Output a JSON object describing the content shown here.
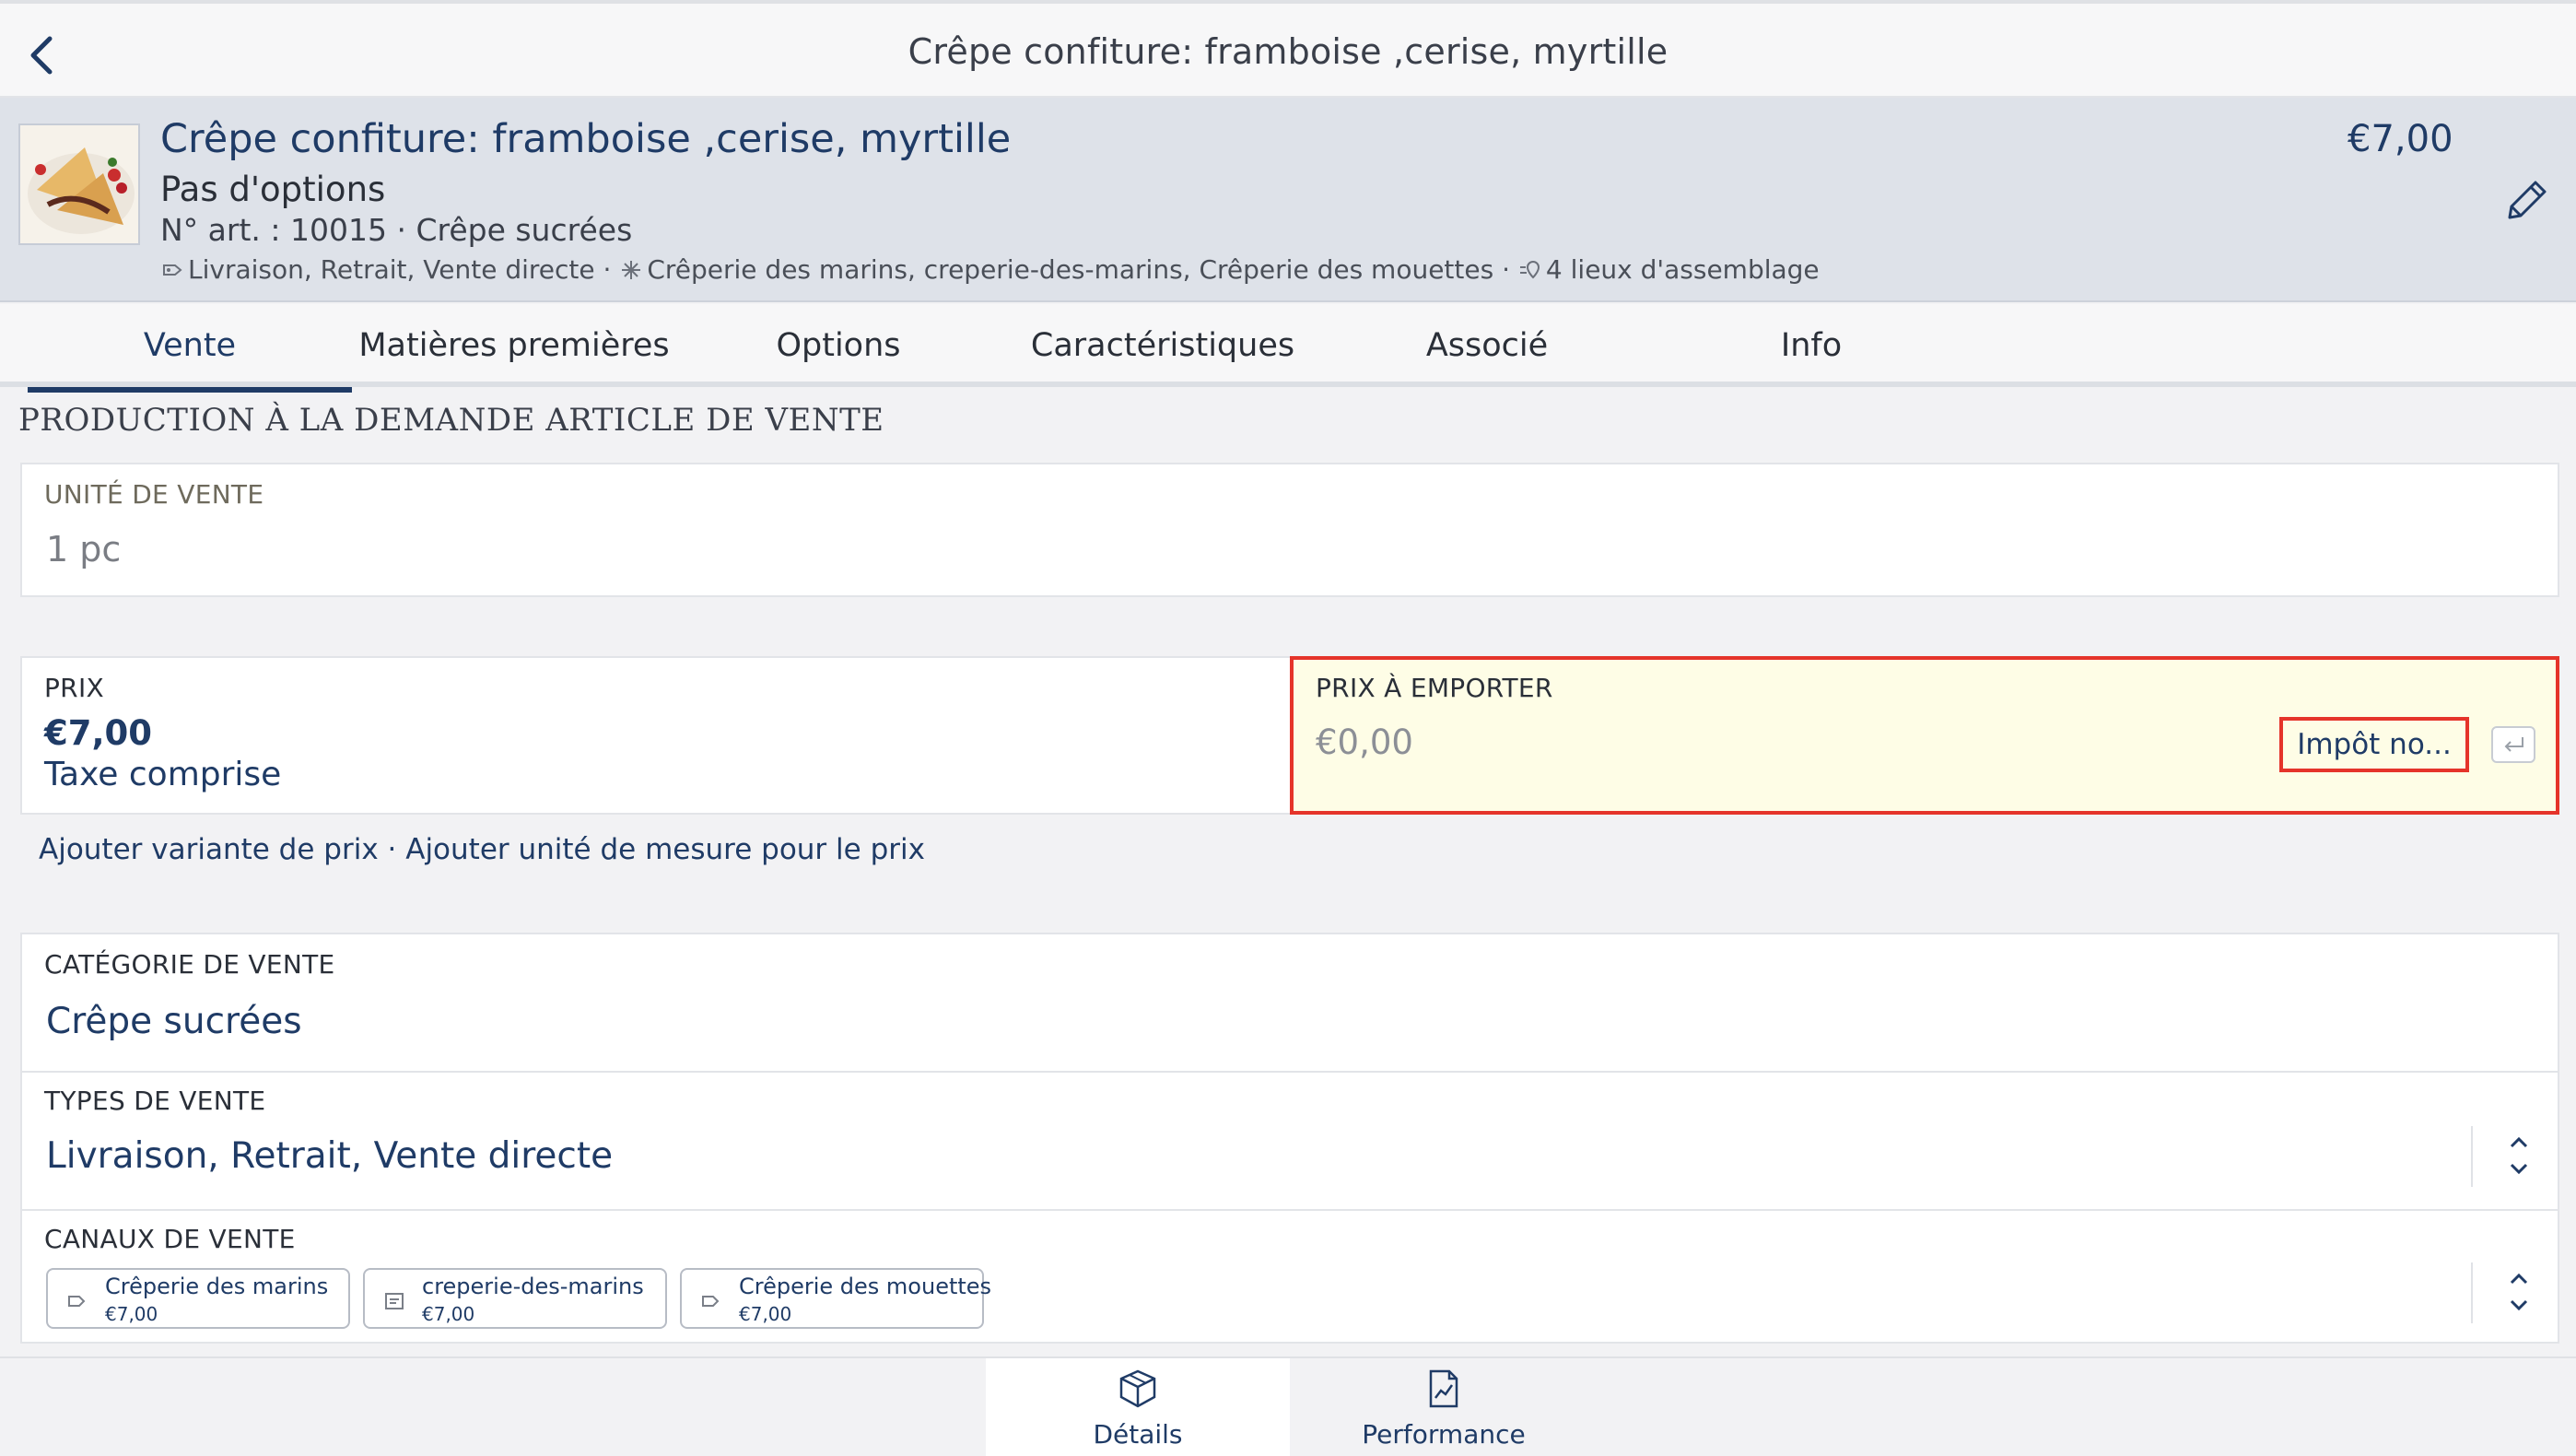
{
  "navbar": {
    "title": "Crêpe confiture: framboise ,cerise, myrtille"
  },
  "product": {
    "title": "Crêpe confiture: framboise ,cerise, myrtille",
    "subtitle": "Pas d'options",
    "article": "N° art. : 10015 · Crêpe sucrées",
    "sale_types": "Livraison, Retrait, Vente directe ·",
    "channels": "Crêperie des marins, creperie-des-marins, Crêperie des mouettes ·",
    "assembly": "4 lieux d'assemblage",
    "price": "€7,00"
  },
  "tabs": [
    {
      "label": "Vente"
    },
    {
      "label": "Matières premières"
    },
    {
      "label": "Options"
    },
    {
      "label": "Caractéristiques"
    },
    {
      "label": "Associé"
    },
    {
      "label": "Info"
    }
  ],
  "section_title": "PRODUCTION À LA DEMANDE ARTICLE DE VENTE",
  "unit": {
    "label": "UNITÉ DE VENTE",
    "value": "1 pc"
  },
  "price": {
    "label": "PRIX",
    "value": "€7,00",
    "tax": "Taxe comprise"
  },
  "takeaway": {
    "label": "PRIX À EMPORTER",
    "placeholder": "€0,00",
    "tax_button": "Impôt no..."
  },
  "links": {
    "add_variant": "Ajouter variante de prix",
    "separator": " · ",
    "add_unit": "Ajouter unité de mesure pour le prix"
  },
  "category": {
    "label": "CATÉGORIE DE VENTE",
    "value": "Crêpe sucrées"
  },
  "types": {
    "label": "TYPES DE VENTE",
    "value": "Livraison, Retrait, Vente directe"
  },
  "channels": {
    "label": "CANAUX DE VENTE",
    "items": [
      {
        "name": "Crêperie des marins",
        "price": "€7,00"
      },
      {
        "name": "creperie-des-marins",
        "price": "€7,00"
      },
      {
        "name": "Crêperie des mouettes",
        "price": "€7,00"
      }
    ]
  },
  "bottom_tabs": [
    {
      "label": "Détails",
      "icon": "box-icon"
    },
    {
      "label": "Performance",
      "icon": "chart-document-icon"
    }
  ],
  "colors": {
    "accent": "#1f3b66",
    "highlight_border": "#e5342a",
    "highlight_bg": "#fefde6"
  }
}
